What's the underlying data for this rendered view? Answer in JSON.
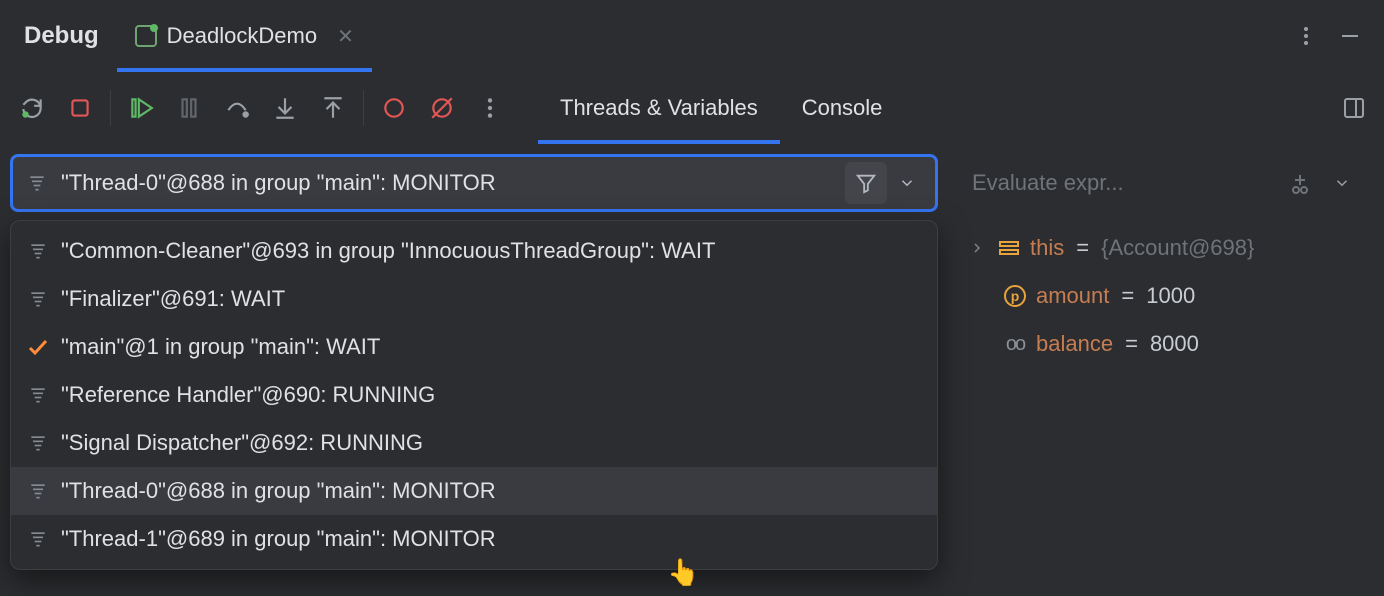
{
  "header": {
    "title": "Debug",
    "tab_label": "DeadlockDemo"
  },
  "subtabs": {
    "threads": "Threads & Variables",
    "console": "Console"
  },
  "thread_select": {
    "current": "\"Thread-0\"@688 in group \"main\": MONITOR"
  },
  "threads": [
    {
      "label": "\"Common-Cleaner\"@693 in group \"InnocuousThreadGroup\": WAIT",
      "current": false,
      "hover": false
    },
    {
      "label": "\"Finalizer\"@691: WAIT",
      "current": false,
      "hover": false
    },
    {
      "label": "\"main\"@1 in group \"main\": WAIT",
      "current": true,
      "hover": false
    },
    {
      "label": "\"Reference Handler\"@690: RUNNING",
      "current": false,
      "hover": false
    },
    {
      "label": "\"Signal Dispatcher\"@692: RUNNING",
      "current": false,
      "hover": false
    },
    {
      "label": "\"Thread-0\"@688 in group \"main\": MONITOR",
      "current": false,
      "hover": true
    },
    {
      "label": "\"Thread-1\"@689 in group \"main\": MONITOR",
      "current": false,
      "hover": false
    }
  ],
  "eval": {
    "placeholder": "Evaluate expr..."
  },
  "variables": {
    "this_name": "this",
    "this_val": "{Account@698}",
    "amount_name": "amount",
    "amount_val": "1000",
    "balance_name": "balance",
    "balance_val": "8000"
  }
}
